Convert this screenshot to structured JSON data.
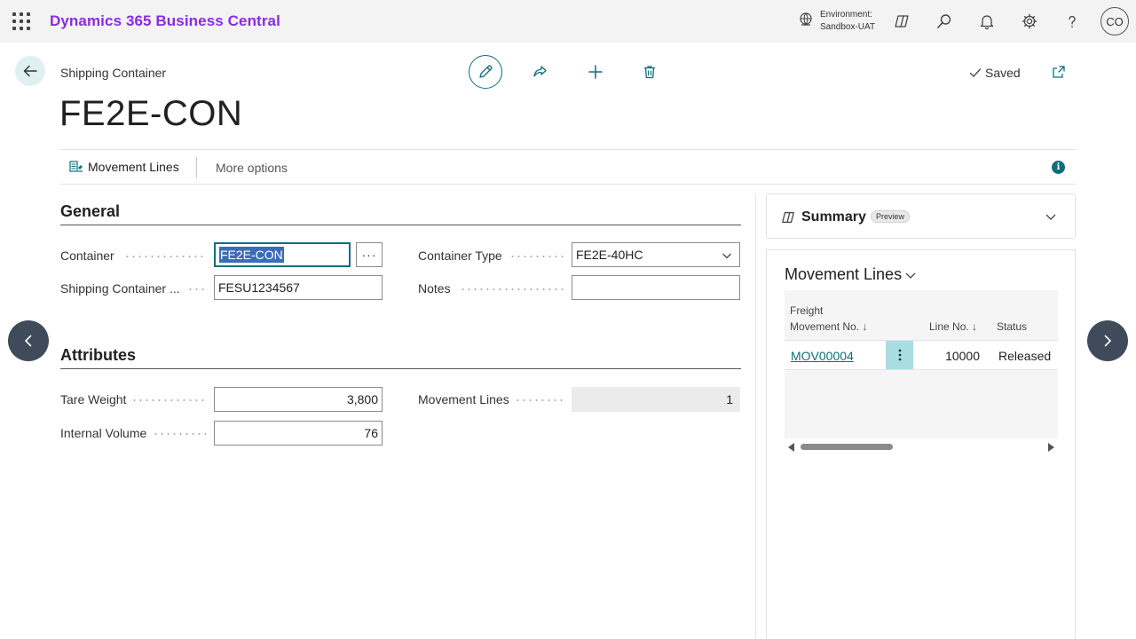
{
  "topbar": {
    "app_name": "Dynamics 365 Business Central",
    "environment_label": "Environment:",
    "environment_name": "Sandbox-UAT",
    "user_initials": "CO"
  },
  "header": {
    "breadcrumb": "Shipping Container",
    "title": "FE2E-CON",
    "status": "Saved"
  },
  "actions": {
    "movement_lines": "Movement Lines",
    "more_options": "More options",
    "info": "i"
  },
  "general": {
    "title": "General",
    "container_label": "Container",
    "container_value": "FE2E-CON",
    "lookup": "···",
    "shipping_container_label": "Shipping Container ...",
    "shipping_container_value": "FESU1234567",
    "container_type_label": "Container Type",
    "container_type_value": "FE2E-40HC",
    "notes_label": "Notes",
    "notes_value": ""
  },
  "attributes": {
    "title": "Attributes",
    "tare_weight_label": "Tare Weight",
    "tare_weight_value": "3,800",
    "internal_volume_label": "Internal Volume",
    "internal_volume_value": "76",
    "movement_lines_label": "Movement Lines",
    "movement_lines_value": "1"
  },
  "factbox": {
    "summary_title": "Summary",
    "preview_badge": "Preview",
    "movement_lines_title": "Movement Lines",
    "columns": {
      "freight_line1": "Freight",
      "freight_line2": "Movement No. ↓",
      "line_no": "Line No. ↓",
      "status": "Status"
    },
    "rows": [
      {
        "movement_no": "MOV00004",
        "line_no": "10000",
        "status": "Released"
      }
    ]
  },
  "colors": {
    "accent": "#0e6e7a",
    "brand": "#8a2be2",
    "selection": "#3b6cb7",
    "nav_arrow": "#3f4b5a"
  }
}
